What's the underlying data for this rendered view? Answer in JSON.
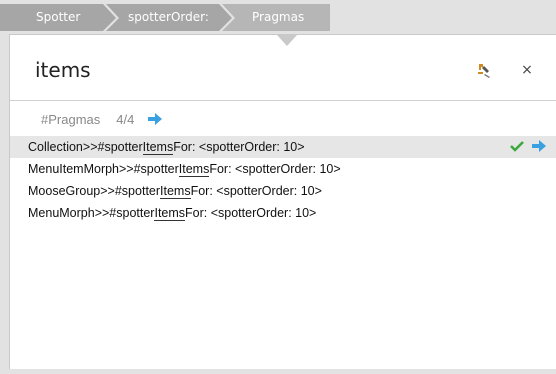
{
  "breadcrumb": {
    "items": [
      {
        "label": "Spotter"
      },
      {
        "label": "spotterOrder:"
      },
      {
        "label": "Pragmas"
      }
    ]
  },
  "panel": {
    "title": "items",
    "close_label": "×"
  },
  "group": {
    "name": "#Pragmas",
    "count": "4/4"
  },
  "results": [
    {
      "prefix": "Collection>>#spotter",
      "highlight": "Items",
      "suffix": "For: <spotterOrder: 10>"
    },
    {
      "prefix": "MenuItemMorph>>#spotter",
      "highlight": "Items",
      "suffix": "For: <spotterOrder: 10>"
    },
    {
      "prefix": "MooseGroup>>#spotter",
      "highlight": "Items",
      "suffix": "For: <spotterOrder: 10>"
    },
    {
      "prefix": "MenuMorph>>#spotter",
      "highlight": "Items",
      "suffix": "For: <spotterOrder: 10>"
    }
  ],
  "colors": {
    "crumb_dark": "#9a9a9a",
    "crumb_active": "#b4b4b4",
    "accent_blue": "#3aa0e0",
    "check_green": "#3aa83a",
    "tool_orange": "#d08a20"
  },
  "icons": {
    "tool": "debug-tool-icon",
    "close": "close-icon",
    "dive_in": "arrow-right-icon",
    "check": "checkmark-icon"
  }
}
